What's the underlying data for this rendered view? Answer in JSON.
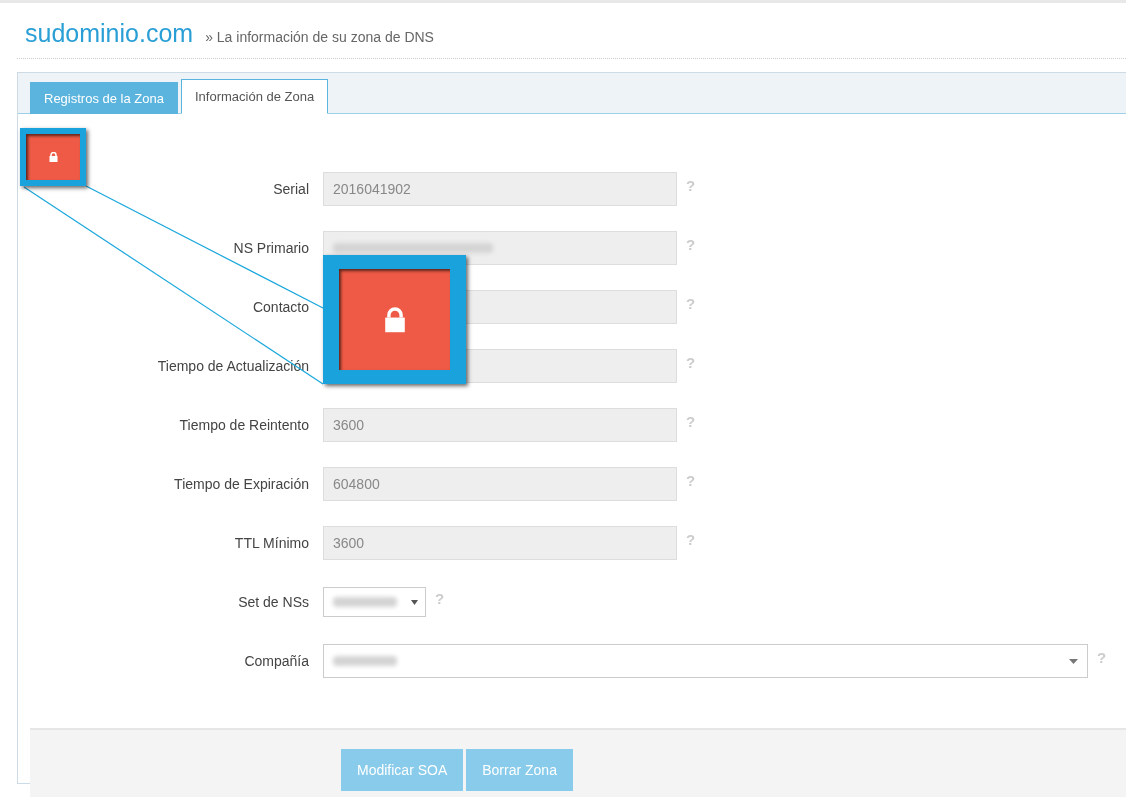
{
  "header": {
    "site": "sudominio.com",
    "breadcrumb": "» La información de su zona de DNS"
  },
  "tabs": [
    {
      "label": "Registros de la Zona",
      "selected": false
    },
    {
      "label": "Información de Zona",
      "selected": true
    }
  ],
  "fields": [
    {
      "kind": "text",
      "label": "Serial",
      "value": "2016041902",
      "help": "?"
    },
    {
      "kind": "text",
      "label": "NS Primario",
      "blurred": true,
      "help": "?"
    },
    {
      "kind": "text",
      "label": "Contacto",
      "help": "?"
    },
    {
      "kind": "text",
      "label": "Tiempo de Actualización",
      "help": "?"
    },
    {
      "kind": "text",
      "label": "Tiempo de Reintento",
      "value": "3600",
      "help": "?"
    },
    {
      "kind": "text",
      "label": "Tiempo de Expiración",
      "value": "604800",
      "help": "?"
    },
    {
      "kind": "text",
      "label": "TTL Mínimo",
      "value": "3600",
      "help": "?"
    },
    {
      "kind": "select",
      "label": "Set de NSs",
      "blurred": true,
      "help": "?"
    },
    {
      "kind": "combo",
      "label": "Compañía",
      "blurred": true,
      "help": "?"
    }
  ],
  "buttons": [
    "Modificar SOA",
    "Borrar Zona"
  ]
}
